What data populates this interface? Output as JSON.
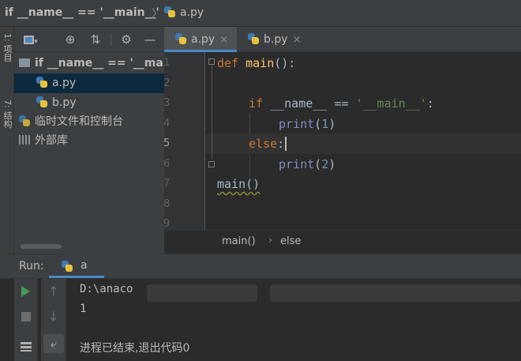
{
  "breadcrumb": {
    "project": "if __name__ == '__main__'",
    "file": "a.py"
  },
  "left_strip": {
    "project_label": "1: 项目",
    "structure_label": "7: 结构"
  },
  "project_panel": {
    "tree": [
      {
        "label": "if __name__ == '__main__'",
        "type": "folder"
      },
      {
        "label": "a.py",
        "type": "python-file",
        "selected": true
      },
      {
        "label": "b.py",
        "type": "python-file"
      },
      {
        "label": "临时文件和控制台",
        "type": "scratches"
      },
      {
        "label": "外部库",
        "type": "libraries"
      }
    ]
  },
  "editor": {
    "tabs": [
      {
        "label": "a.py",
        "active": true,
        "close": "×"
      },
      {
        "label": "b.py",
        "active": false,
        "close": "×"
      }
    ],
    "line_numbers": [
      "1",
      "2",
      "3",
      "4",
      "5",
      "6",
      "7",
      "8",
      "9"
    ],
    "code": {
      "l1_kw": "def",
      "l1_name": "main",
      "l1_rest": "():",
      "l3_kw": "if",
      "l3_mid": " __name__ == ",
      "l3_str": "'__main__'",
      "l3_end": ":",
      "l4_bi": "print",
      "l4_open": "(",
      "l4_num": "1",
      "l4_close": ")",
      "l5_kw": "else",
      "l5_end": ":",
      "l6_bi": "print",
      "l6_open": "(",
      "l6_num": "2",
      "l6_close": ")",
      "l7": "main()"
    },
    "crumbs": [
      "main()",
      "else"
    ]
  },
  "run": {
    "title": "Run:",
    "tab_label": "a",
    "output": [
      "D:\\anaco",
      "1",
      "进程已结束,退出代码0"
    ]
  },
  "colors": {
    "keyword": "#cc7832",
    "function": "#ffc66d",
    "string": "#6a8759",
    "number": "#6897bb",
    "selection": "#0d293e",
    "run_green": "#499c54"
  }
}
